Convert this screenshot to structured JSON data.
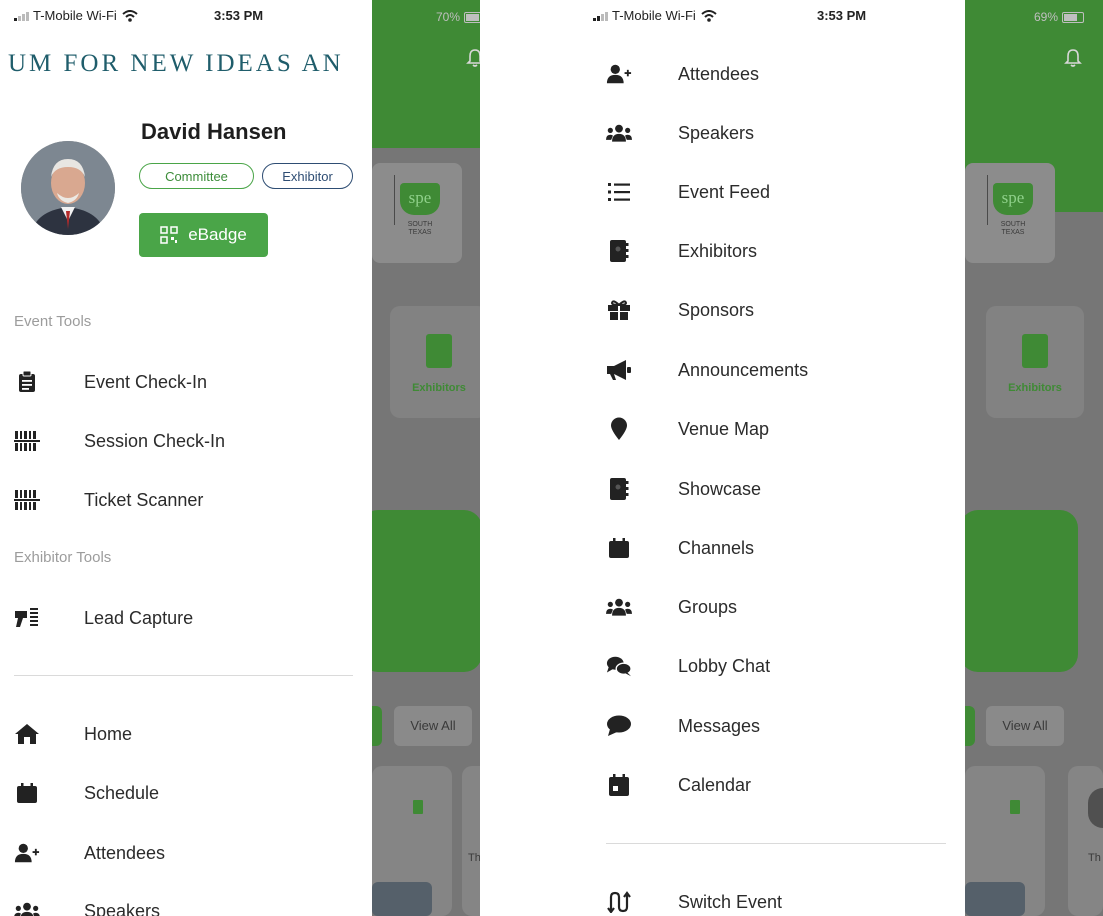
{
  "colors": {
    "brand_green": "#4aa548",
    "header_green": "#3f8a35",
    "badge_blue": "#2e4d73",
    "banner_teal": "#1f5d6b"
  },
  "left": {
    "status": {
      "carrier": "T-Mobile Wi-Fi",
      "time": "3:53 PM",
      "battery": "70%"
    },
    "banner_text": "UM FOR NEW IDEAS AN",
    "profile": {
      "name": "David Hansen",
      "badges": [
        "Committee",
        "Exhibitor"
      ],
      "ebadge_label": "eBadge"
    },
    "sections": {
      "event_tools": "Event Tools",
      "exhibitor_tools": "Exhibitor Tools"
    },
    "event_tools": [
      {
        "label": "Event Check-In",
        "icon": "clipboard-icon"
      },
      {
        "label": "Session Check-In",
        "icon": "barcode-icon"
      },
      {
        "label": "Ticket Scanner",
        "icon": "barcode-icon"
      }
    ],
    "exhibitor_tools": [
      {
        "label": "Lead Capture",
        "icon": "barcode-scanner-icon"
      }
    ],
    "nav": [
      {
        "label": "Home",
        "icon": "home-icon"
      },
      {
        "label": "Schedule",
        "icon": "calendar-icon"
      },
      {
        "label": "Attendees",
        "icon": "user-plus-icon"
      },
      {
        "label": "Speakers",
        "icon": "users-icon"
      }
    ],
    "background": {
      "tile_label": "Exhibitors",
      "view_all": "View All",
      "card_text": "Th",
      "logo_brand": "spe",
      "logo_sub": "SOUTH TEXAS"
    }
  },
  "right": {
    "status": {
      "carrier": "T-Mobile Wi-Fi",
      "time": "3:53 PM",
      "battery": "69%"
    },
    "nav": [
      {
        "label": "Attendees",
        "icon": "user-plus-icon"
      },
      {
        "label": "Speakers",
        "icon": "users-icon"
      },
      {
        "label": "Event Feed",
        "icon": "list-icon"
      },
      {
        "label": "Exhibitors",
        "icon": "address-book-icon"
      },
      {
        "label": "Sponsors",
        "icon": "gift-icon"
      },
      {
        "label": "Announcements",
        "icon": "megaphone-icon"
      },
      {
        "label": "Venue Map",
        "icon": "map-pin-icon"
      },
      {
        "label": "Showcase",
        "icon": "address-book-icon"
      },
      {
        "label": "Channels",
        "icon": "calendar-icon"
      },
      {
        "label": "Groups",
        "icon": "users-icon"
      },
      {
        "label": "Lobby Chat",
        "icon": "chat-bubbles-icon"
      },
      {
        "label": "Messages",
        "icon": "chat-bubble-icon"
      },
      {
        "label": "Calendar",
        "icon": "calendar-day-icon"
      }
    ],
    "switch_event": {
      "label": "Switch Event",
      "icon": "switch-arrows-icon"
    },
    "background": {
      "tile_label": "Exhibitors",
      "view_all": "View All",
      "card_text": "Th",
      "logo_brand": "spe",
      "logo_sub": "SOUTH TEXAS"
    }
  }
}
